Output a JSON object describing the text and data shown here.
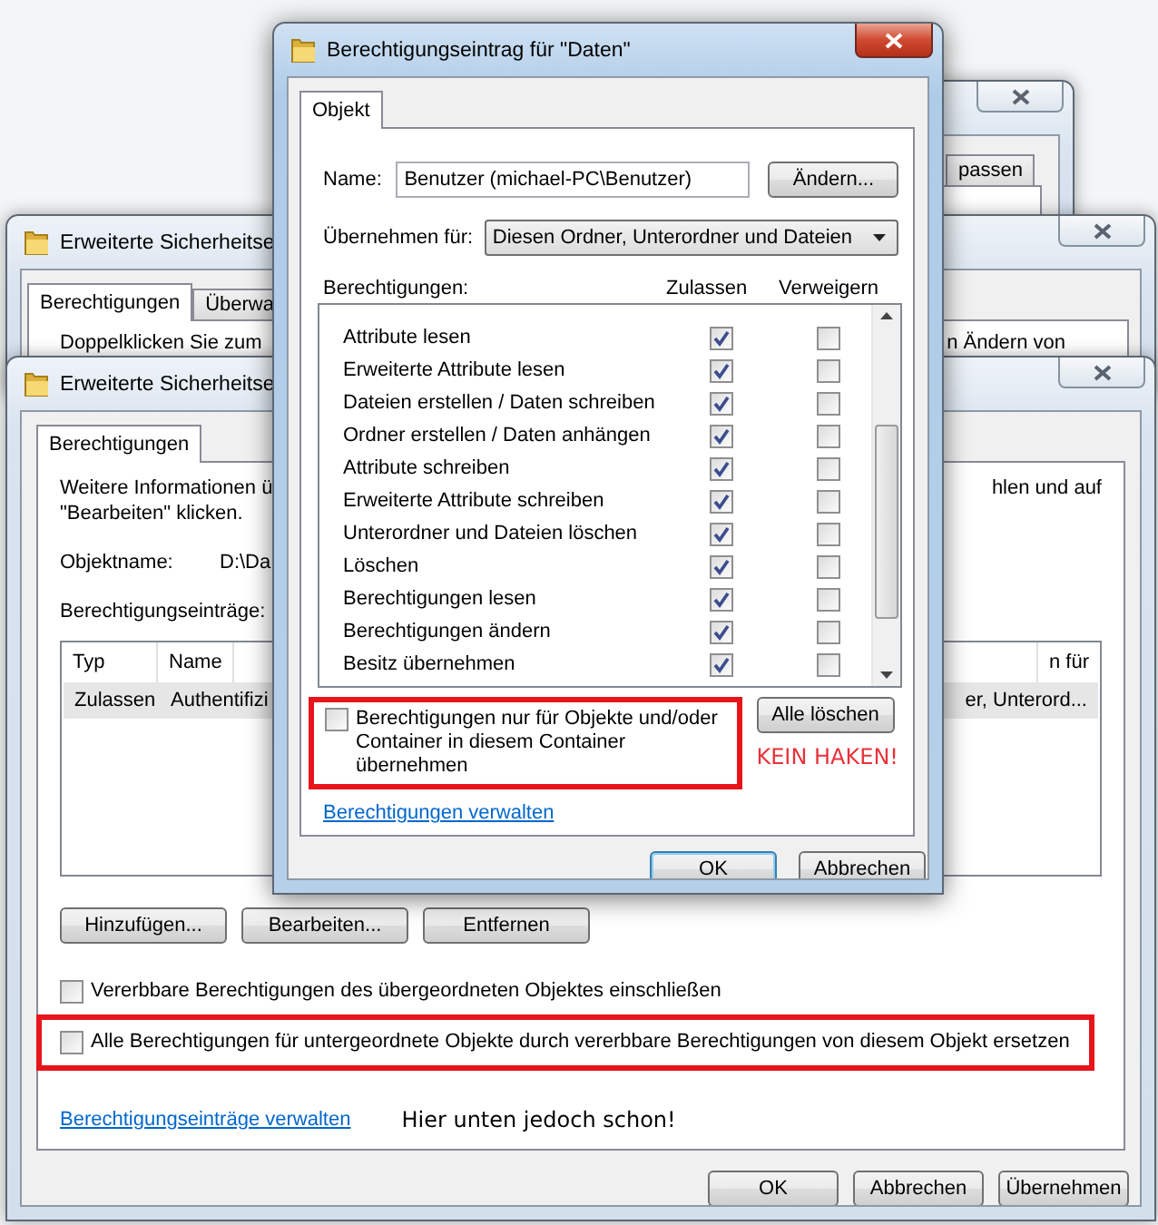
{
  "back_window_top": {
    "tabs": [
      {
        "label": "passen",
        "selected": false
      }
    ]
  },
  "back_window_middle": {
    "title": "Erweiterte Sicherheitse",
    "tabs": [
      {
        "label": "Berechtigungen",
        "selected": true
      },
      {
        "label": "Überwa",
        "selected": false
      }
    ],
    "hint_left": "Doppelklicken Sie zum",
    "hint_right": "n Ändern von"
  },
  "main_window": {
    "title": "Erweiterte Sicherheitse",
    "tabs": [
      {
        "label": "Berechtigungen",
        "selected": true
      }
    ],
    "info_left": "Weitere Informationen ü",
    "info_right": "hlen und auf",
    "info_line_2": "\"Bearbeiten\" klicken.",
    "object_name_label": "Objektname:",
    "object_name_value": "D:\\Da",
    "entries_label": "Berechtigungseinträge:",
    "table": {
      "columns": [
        "Typ",
        "Name"
      ],
      "column_right": "n für",
      "rows": [
        {
          "cells": [
            "Zulassen",
            "Authentifizi"
          ],
          "right": "er, Unterord...",
          "selected": true
        }
      ]
    },
    "buttons": [
      "Hinzufügen...",
      "Bearbeiten...",
      "Entfernen"
    ],
    "options": [
      {
        "label": "Vererbbare Berechtigungen des übergeordneten Objektes einschließen",
        "checked": false,
        "highlighted": false
      },
      {
        "label": "Alle Berechtigungen für untergeordnete Objekte durch vererbbare Berechtigungen von diesem Objekt ersetzen",
        "checked": false,
        "highlighted": true
      }
    ],
    "link": "Berechtigungseinträge verwalten",
    "annotation": "Hier unten jedoch schon!",
    "footer_buttons": [
      "OK",
      "Abbrechen",
      "Übernehmen"
    ]
  },
  "dialog": {
    "title": "Berechtigungseintrag für \"Daten\"",
    "tabs": [
      {
        "label": "Objekt",
        "selected": true
      }
    ],
    "name_label": "Name:",
    "name_value": "Benutzer (michael-PC\\Benutzer)",
    "change_button": "Ändern...",
    "apply_label": "Übernehmen für:",
    "apply_value": "Diesen Ordner, Unterordner und Dateien",
    "permissions_label": "Berechtigungen:",
    "columns": [
      "Zulassen",
      "Verweigern"
    ],
    "permissions": [
      {
        "name": "Attribute lesen",
        "allow": true,
        "deny": false
      },
      {
        "name": "Erweiterte Attribute lesen",
        "allow": true,
        "deny": false
      },
      {
        "name": "Dateien erstellen / Daten schreiben",
        "allow": true,
        "deny": false
      },
      {
        "name": "Ordner erstellen / Daten anhängen",
        "allow": true,
        "deny": false
      },
      {
        "name": "Attribute schreiben",
        "allow": true,
        "deny": false
      },
      {
        "name": "Erweiterte Attribute schreiben",
        "allow": true,
        "deny": false
      },
      {
        "name": "Unterordner und Dateien löschen",
        "allow": true,
        "deny": false
      },
      {
        "name": "Löschen",
        "allow": true,
        "deny": false
      },
      {
        "name": "Berechtigungen lesen",
        "allow": true,
        "deny": false
      },
      {
        "name": "Berechtigungen ändern",
        "allow": true,
        "deny": false
      },
      {
        "name": "Besitz übernehmen",
        "allow": true,
        "deny": false
      }
    ],
    "inherit_option": {
      "label": "Berechtigungen nur für Objekte und/oder Container in diesem Container übernehmen",
      "checked": false,
      "highlighted": true
    },
    "clear_button": "Alle löschen",
    "annotation": "KEIN HAKEN!",
    "link": "Berechtigungen verwalten",
    "buttons": [
      "OK",
      "Abbrechen"
    ]
  }
}
